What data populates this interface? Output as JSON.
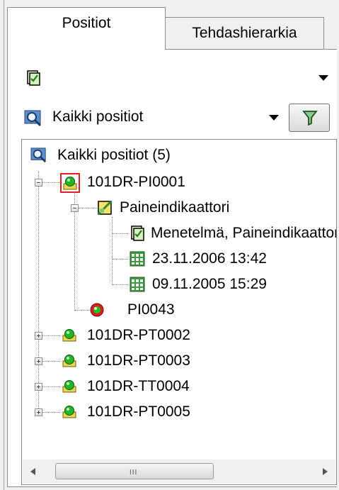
{
  "tabs": [
    {
      "label": "Positiot",
      "active": true
    },
    {
      "label": "Tehdashierarkia",
      "active": false
    }
  ],
  "method_combo": {
    "value": "",
    "icon": "document-check-icon"
  },
  "position_filter_combo": {
    "value": "Kaikki positiot",
    "icon": "magnifier-icon"
  },
  "filter_button": {
    "icon": "funnel-icon"
  },
  "tree": {
    "root": {
      "label": "Kaikki positiot (5)",
      "icon": "magnifier-icon"
    },
    "pos1": {
      "label": "101DR-PI0001",
      "icon": "sensor-green-icon",
      "selected": true
    },
    "device": {
      "label": "Paineindikaattori",
      "icon": "device-icon"
    },
    "method": {
      "label": "Menetelmä, Paineindikaattori",
      "icon": "document-check-icon"
    },
    "date1": {
      "label": "23.11.2006 13:42",
      "icon": "calendar-grid-icon"
    },
    "date2": {
      "label": "09.11.2005 15:29",
      "icon": "calendar-grid-icon"
    },
    "sub": {
      "label": "PI0043",
      "icon": "status-red-green-icon"
    },
    "pos2": {
      "label": "101DR-PT0002",
      "icon": "sensor-yellow-icon"
    },
    "pos3": {
      "label": "101DR-PT0003",
      "icon": "sensor-yellow-icon"
    },
    "pos4": {
      "label": "101DR-TT0004",
      "icon": "sensor-yellow-icon"
    },
    "pos5": {
      "label": "101DR-PT0005",
      "icon": "sensor-yellow-icon"
    }
  },
  "scrollbar": {
    "grip": "III"
  },
  "colors": {
    "selection_border": "#e02020",
    "tree_border": "#828790",
    "tab_border": "#898c95"
  }
}
